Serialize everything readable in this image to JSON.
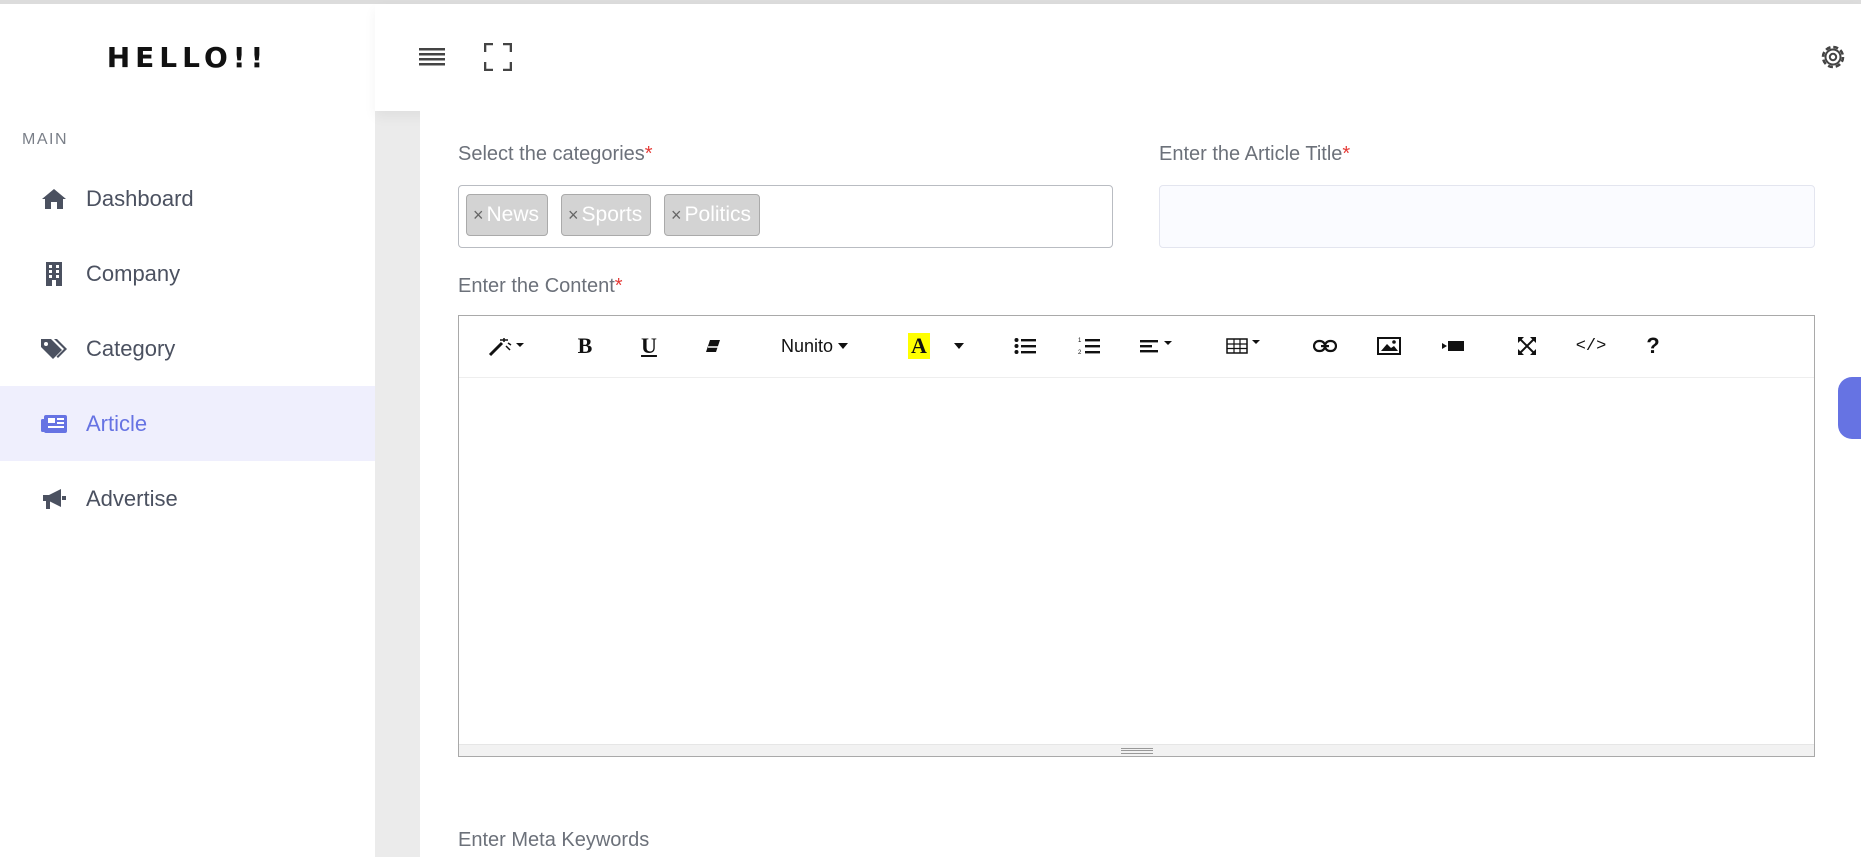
{
  "app": {
    "brand": "HELLO!!"
  },
  "sidebar": {
    "menu_title": "MAIN",
    "items": [
      {
        "label": "Dashboard",
        "icon": "home-icon",
        "active": false
      },
      {
        "label": "Company",
        "icon": "building-icon",
        "active": false
      },
      {
        "label": "Category",
        "icon": "tags-icon",
        "active": false
      },
      {
        "label": "Article",
        "icon": "newspaper-icon",
        "active": true
      },
      {
        "label": "Advertise",
        "icon": "bullhorn-icon",
        "active": false
      }
    ]
  },
  "topbar": {
    "menu_icon": "hamburger-icon",
    "fullscreen_icon": "fullscreen-icon",
    "settings_icon": "gear-icon"
  },
  "form": {
    "categories_label": "Select the categories",
    "required_mark": "*",
    "categories": [
      "News",
      "Sports",
      "Politics"
    ],
    "chip_remove": "×",
    "title_label": "Enter the Article Title",
    "title_value": "",
    "content_label": "Enter the Content",
    "meta_keywords_label": "Enter Meta Keywords"
  },
  "editor": {
    "font_name": "Nunito",
    "color_glyph": "A",
    "code_glyph": "</>",
    "help_glyph": "?",
    "bold_glyph": "B",
    "underline_glyph": "U"
  },
  "colors": {
    "accent": "#6673e3",
    "active_bg": "#efeffd",
    "required": "#e53935",
    "highlight": "#ffff00"
  }
}
